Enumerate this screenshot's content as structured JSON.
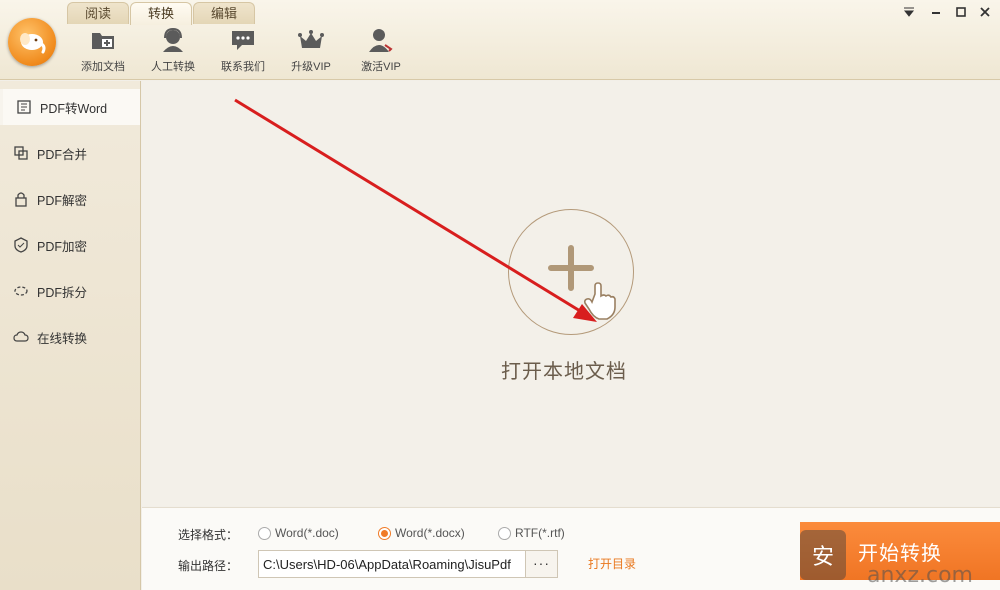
{
  "tabs": [
    "阅读",
    "转换",
    "编辑"
  ],
  "toolbar": [
    {
      "icon": "add-folder-icon",
      "label": "添加文档"
    },
    {
      "icon": "support-agent-icon",
      "label": "人工转换"
    },
    {
      "icon": "chat-bubble-icon",
      "label": "联系我们"
    },
    {
      "icon": "crown-icon",
      "label": "升级VIP"
    },
    {
      "icon": "user-key-icon",
      "label": "激活VIP"
    }
  ],
  "sidebar": {
    "items": [
      {
        "icon": "word-doc-icon",
        "label": "PDF转Word"
      },
      {
        "icon": "merge-icon",
        "label": "PDF合并"
      },
      {
        "icon": "unlock-icon",
        "label": "PDF解密"
      },
      {
        "icon": "shield-icon",
        "label": "PDF加密"
      },
      {
        "icon": "split-icon",
        "label": "PDF拆分"
      },
      {
        "icon": "cloud-icon",
        "label": "在线转换"
      }
    ]
  },
  "main": {
    "open_label": "打开本地文档"
  },
  "bottom": {
    "format_label": "选择格式：",
    "formats": [
      "Word(*.doc)",
      "Word(*.docx)",
      "RTF(*.rtf)"
    ],
    "selected_format": "Word(*.docx)",
    "path_label": "输出路径：",
    "path_value": "C:\\Users\\HD-06\\AppData\\Roaming\\JisuPdf",
    "browse_label": "···",
    "open_dir_label": "打开目录",
    "start_label": "开始转换"
  },
  "watermark": {
    "site": "anxz.com",
    "glyph": "安"
  },
  "colors": {
    "accent": "#f07b27",
    "arrow": "#d81e1e"
  }
}
